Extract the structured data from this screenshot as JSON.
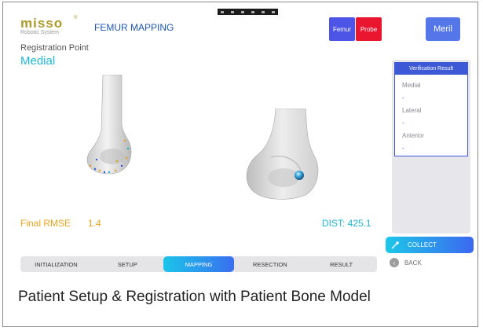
{
  "app": {
    "logo_text": "misso",
    "logo_mark": "®",
    "logo_subtitle": "Robotic System",
    "page_title": "FEMUR MAPPING"
  },
  "header_buttons": {
    "femur": "Femur",
    "probe": "Probe",
    "brand": "Meril"
  },
  "registration": {
    "label": "Registration Point",
    "value": "Medial"
  },
  "verification": {
    "title": "Verification Result",
    "rows": [
      {
        "label": "Medial",
        "value": "-"
      },
      {
        "label": "Lateral",
        "value": "-"
      },
      {
        "label": "Anterior",
        "value": "-"
      }
    ]
  },
  "metrics": {
    "rmse_label": "Final RMSE",
    "rmse_value": "1.4",
    "dist_label": "DIST: 425.1"
  },
  "actions": {
    "collect": "COLLECT",
    "back": "BACK"
  },
  "steps": [
    {
      "label": "INITIALIZATION"
    },
    {
      "label": "SETUP"
    },
    {
      "label": "MAPPING",
      "active": true
    },
    {
      "label": "RESECTION"
    },
    {
      "label": "RESULT"
    }
  ],
  "caption": "Patient Setup & Registration with Patient Bone Model",
  "colors": {
    "accent_cyan": "#1cb8d6",
    "accent_blue": "#3e59d6",
    "rmse_orange": "#f2a21b",
    "femur_button": "#4c55e6",
    "probe_button": "#ea1630",
    "logo_gold": "#ad9a2a"
  },
  "icons": {
    "collect": "probe-icon",
    "back": "chevron-left-icon"
  }
}
